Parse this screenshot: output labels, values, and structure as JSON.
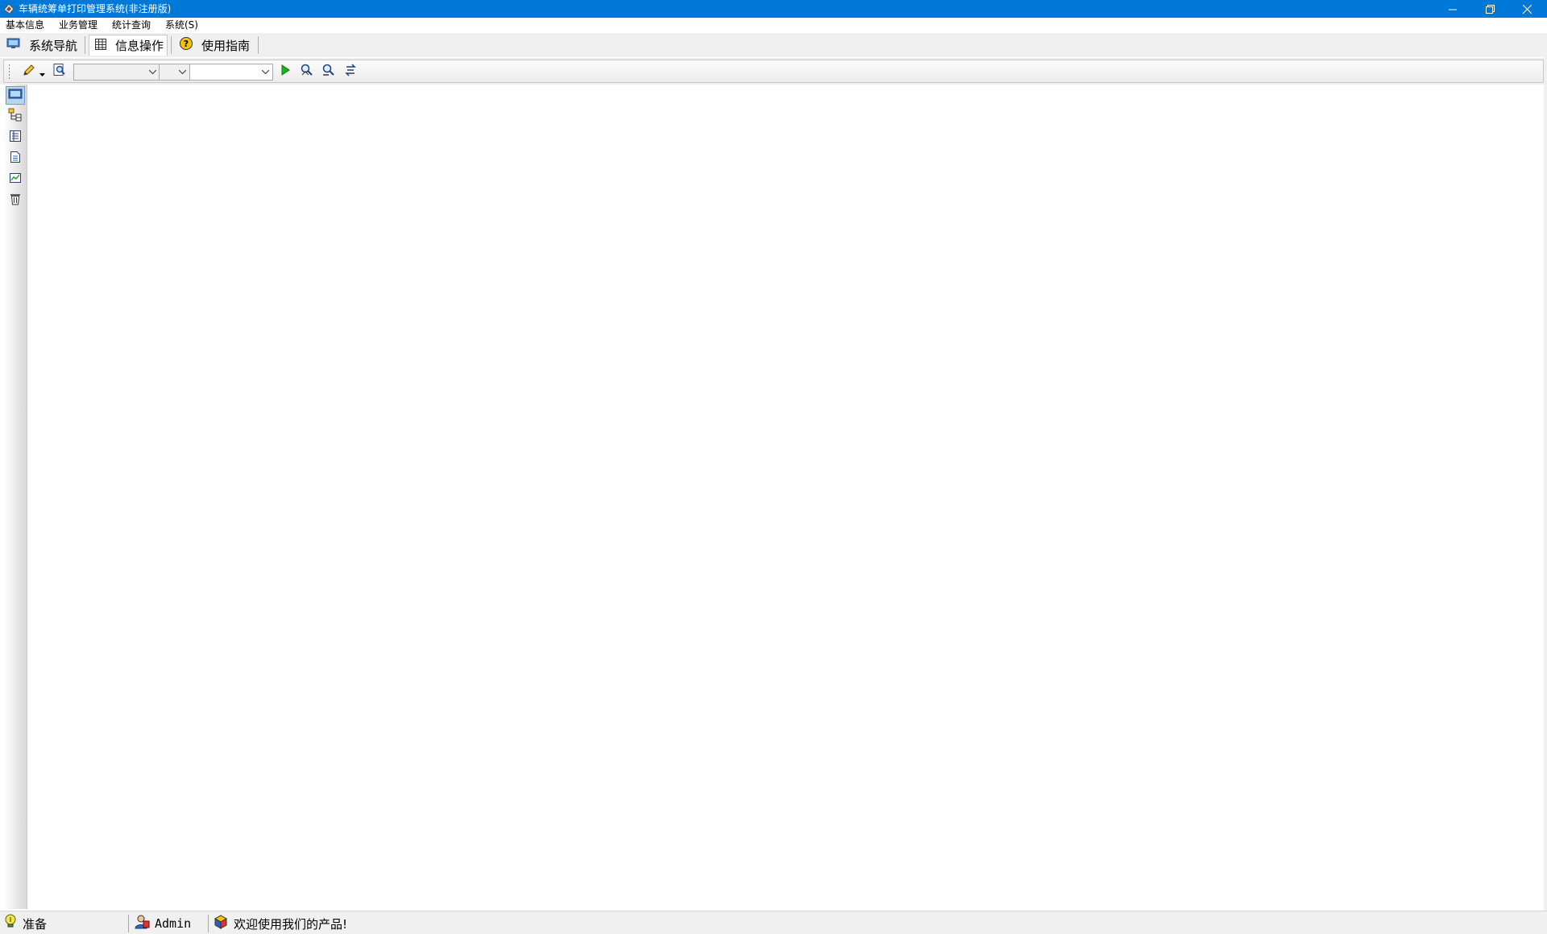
{
  "window": {
    "title": "车辆统筹单打印管理系统(非注册版)",
    "buttons": [
      "minimize-icon",
      "restore-icon",
      "close-icon"
    ]
  },
  "menu": {
    "items": [
      {
        "label": "基本信息"
      },
      {
        "label": "业务管理"
      },
      {
        "label": "统计查询"
      },
      {
        "label": "系统(S)"
      }
    ]
  },
  "tabs": [
    {
      "label": "系统导航",
      "icon": "monitor-icon",
      "active": false
    },
    {
      "label": "信息操作",
      "icon": "table-grid-icon",
      "active": true
    },
    {
      "label": "使用指南",
      "icon": "help-question-icon",
      "active": false
    }
  ],
  "toolbar": {
    "buttons": [
      "pencil-edit-icon",
      "preview-icon",
      "run-play-icon",
      "find-icon",
      "find-next-icon",
      "refresh-filter-icon"
    ],
    "combo1": {
      "value": ""
    },
    "combo2": {
      "value": ""
    },
    "combo3": {
      "value": ""
    }
  },
  "sidebar": {
    "items": [
      "screen-icon",
      "tree-structure-icon",
      "list-view-icon",
      "document-icon",
      "chart-image-icon",
      "delete-bin-icon"
    ]
  },
  "status": {
    "state": "准备",
    "user": "Admin",
    "message": "欢迎使用我们的产品!"
  },
  "colors": {
    "titlebar": "#0078d7",
    "chrome": "#f0f0f0",
    "active_side": "#b9d4f0"
  }
}
